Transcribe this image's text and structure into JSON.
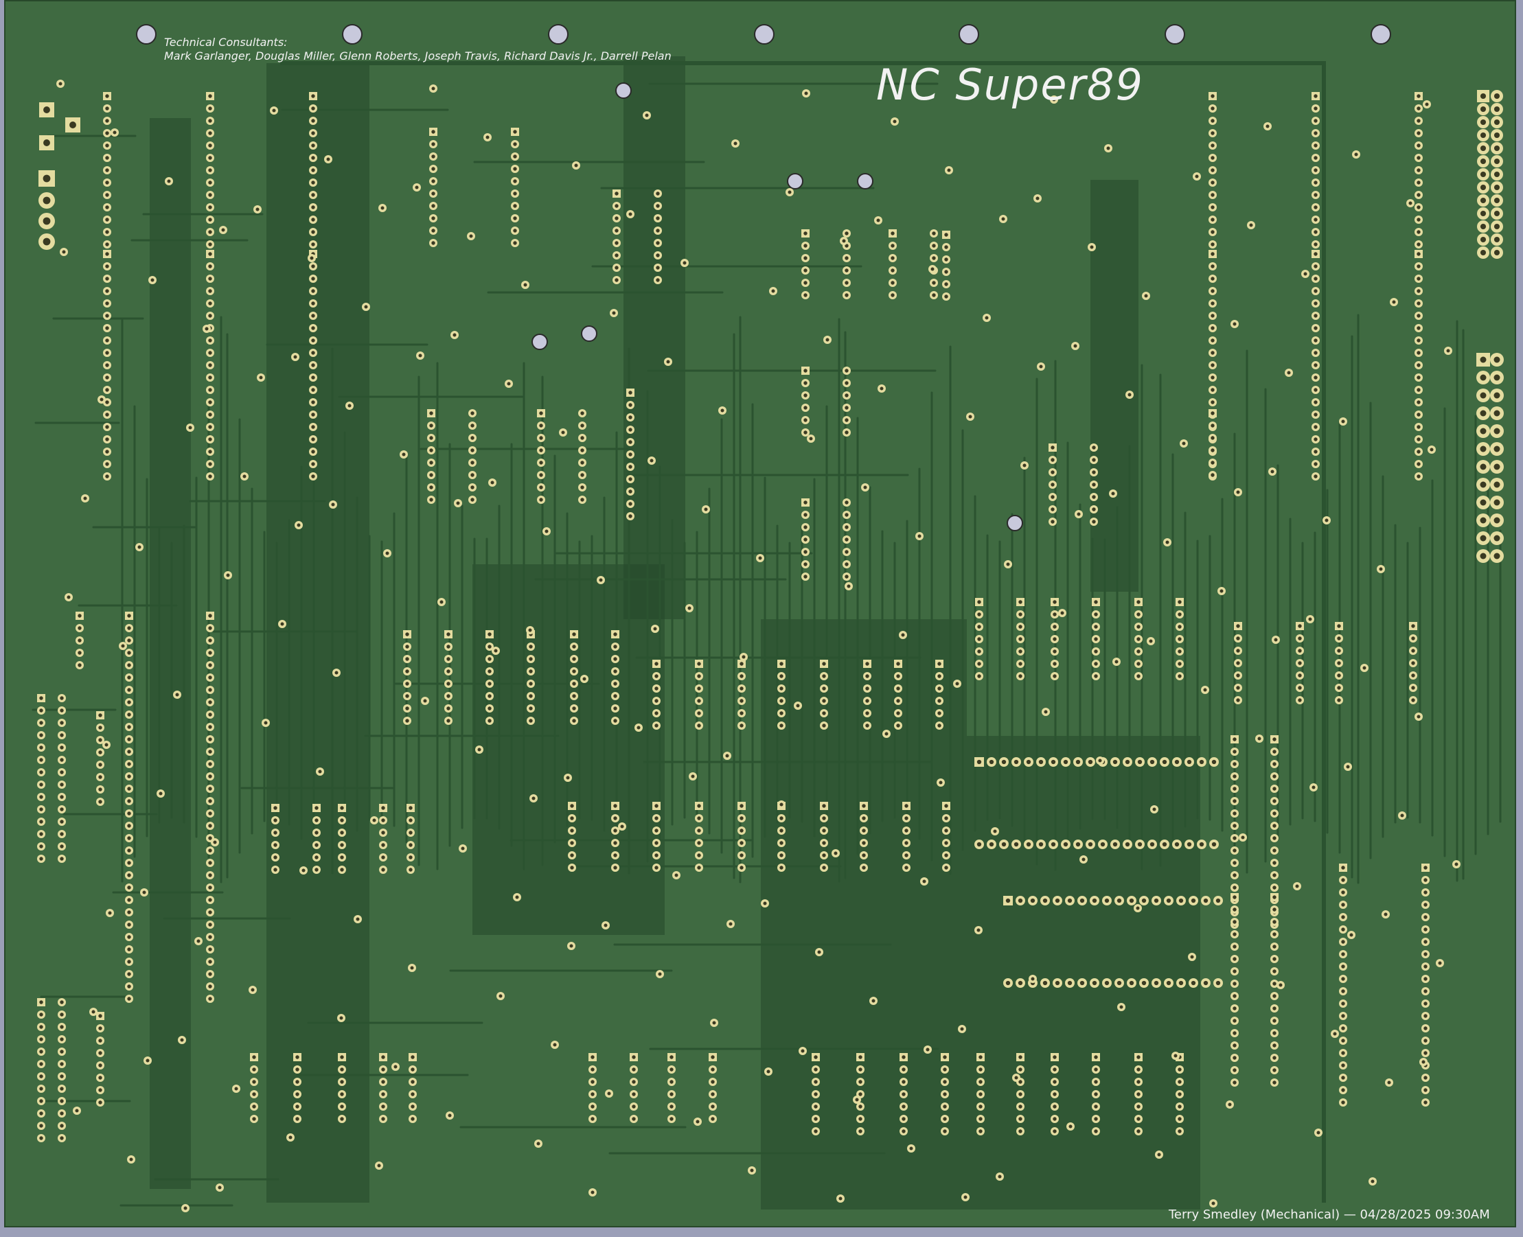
{
  "board": {
    "title": "NC Super89",
    "consultants_heading": "Technical Consultants:",
    "consultants_names": "Mark Garlanger, Douglas Miller, Glenn Roberts, Joseph Travis, Richard Davis Jr., Darrell Pelan",
    "designer_line": "Terry Smedley (Mechanical) — 04/28/2025 09:30AM"
  },
  "colors": {
    "background": "#9b9fb8",
    "board": "#3f6a41",
    "trace": "#2b5330",
    "copper_pour": "#24472a",
    "pad": "#e4dca0",
    "pad_hole": "#3a3a22",
    "mounting_hole": "#c8c9dc",
    "silkscreen": "#f2f2f2"
  }
}
